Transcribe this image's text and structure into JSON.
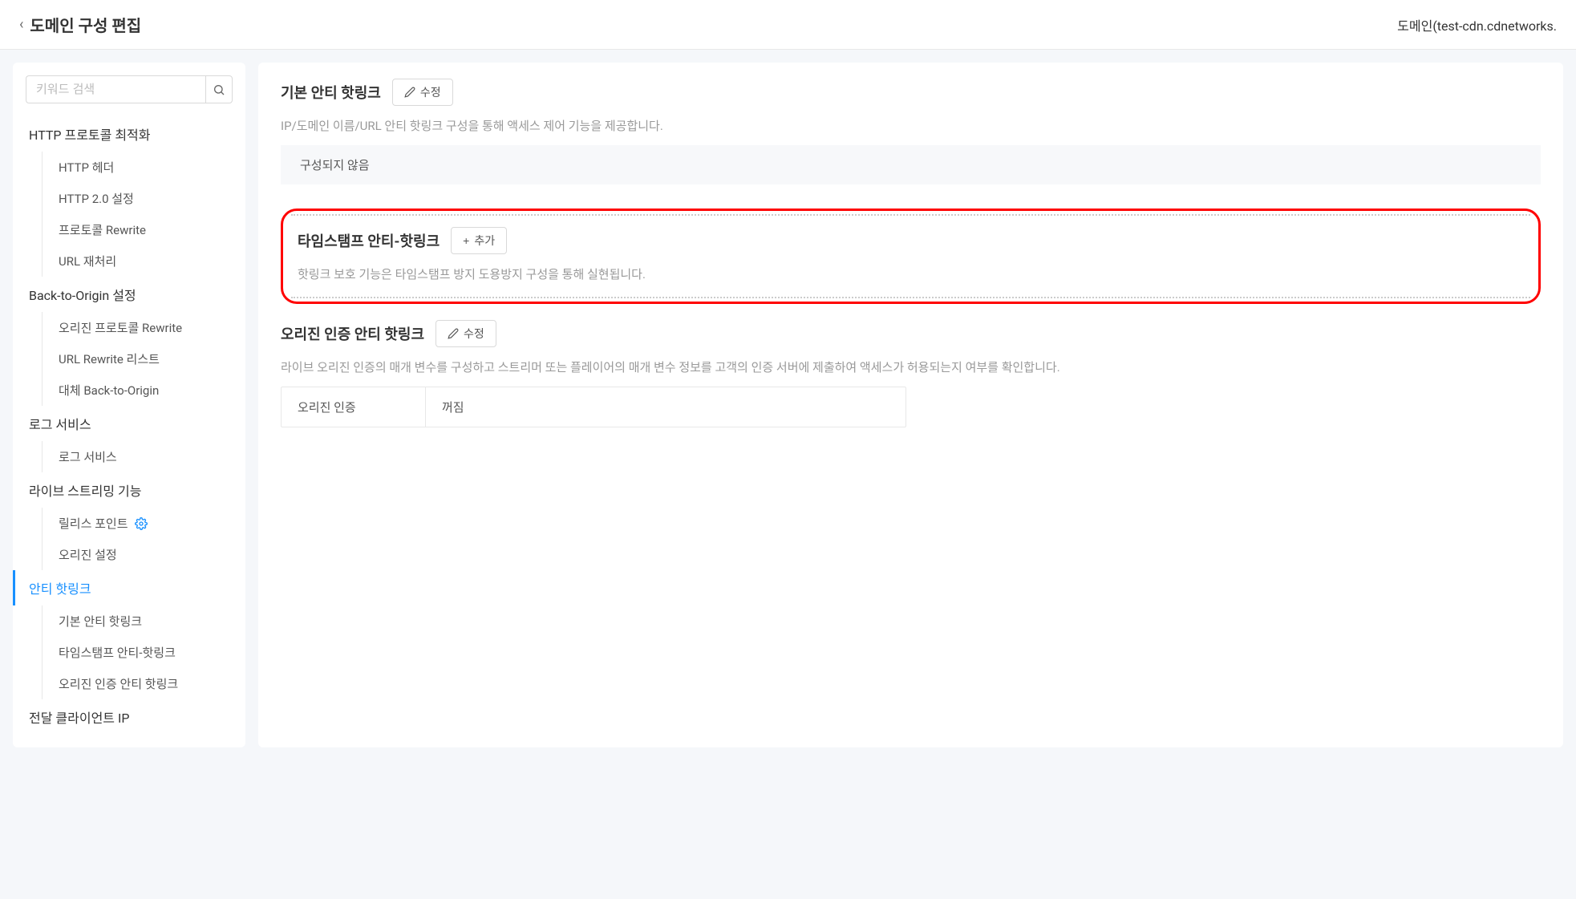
{
  "header": {
    "title": "도메인 구성 편집",
    "domain_label": "도메인(test-cdn.cdnetworks."
  },
  "sidebar": {
    "search_placeholder": "키워드 검색",
    "sections": [
      {
        "title": "HTTP 프로토콜 최적화",
        "items": [
          "HTTP 헤더",
          "HTTP 2.0 설정",
          "프로토콜 Rewrite",
          "URL 재처리"
        ]
      },
      {
        "title": "Back-to-Origin 설정",
        "items": [
          "오리진 프로토콜 Rewrite",
          "URL Rewrite 리스트",
          "대체 Back-to-Origin"
        ]
      },
      {
        "title": "로그 서비스",
        "items": [
          "로그 서비스"
        ]
      },
      {
        "title": "라이브 스트리밍 기능",
        "items_with_icon": [
          {
            "label": "릴리스 포인트",
            "has_gear": true
          },
          {
            "label": "오리진 설정",
            "has_gear": false
          }
        ]
      },
      {
        "title": "안티 핫링크",
        "active": true,
        "items": [
          "기본 안티 핫링크",
          "타임스탬프 안티-핫링크",
          "오리진 인증 안티 핫링크"
        ]
      },
      {
        "title": "전달 클라이언트 IP",
        "items": []
      }
    ]
  },
  "main": {
    "section_basic": {
      "title": "기본 안티 핫링크",
      "button": "수정",
      "desc": "IP/도메인 이름/URL 안티 핫링크 구성을 통해 액세스 제어 기능을 제공합니다.",
      "status": "구성되지 않음"
    },
    "section_timestamp": {
      "title": "타임스탬프 안티-핫링크",
      "button": "추가",
      "desc": "핫링크 보호 기능은 타임스탬프 방지 도용방지 구성을 통해 실현됩니다."
    },
    "section_origin": {
      "title": "오리진 인증 안티 핫링크",
      "button": "수정",
      "desc": "라이브 오리진 인증의 매개 변수를 구성하고 스트리머 또는 플레이어의 매개 변수 정보를 고객의 인증 서버에 제출하여 액세스가 허용되는지 여부를 확인합니다.",
      "table_label": "오리진 인증",
      "table_value": "꺼짐"
    }
  }
}
